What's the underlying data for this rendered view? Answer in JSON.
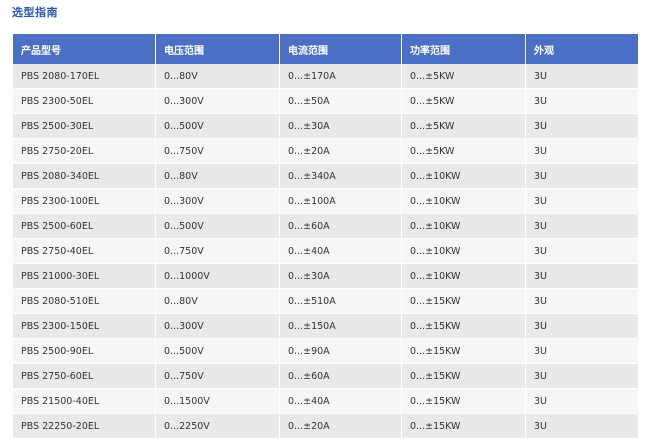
{
  "title": "选型指南",
  "table": {
    "headers": [
      "产品型号",
      "电压范围",
      "电流范围",
      "功率范围",
      "外观"
    ],
    "rows": [
      [
        "PBS 2080-170EL",
        "0...80V",
        "0...±170A",
        "0...±5KW",
        "3U"
      ],
      [
        "PBS 2300-50EL",
        "0...300V",
        "0...±50A",
        "0...±5KW",
        "3U"
      ],
      [
        "PBS 2500-30EL",
        "0...500V",
        "0...±30A",
        "0...±5KW",
        "3U"
      ],
      [
        "PBS 2750-20EL",
        "0...750V",
        "0...±20A",
        "0...±5KW",
        "3U"
      ],
      [
        "PBS 2080-340EL",
        "0...80V",
        "0...±340A",
        "0...±10KW",
        "3U"
      ],
      [
        "PBS 2300-100EL",
        "0...300V",
        "0...±100A",
        "0...±10KW",
        "3U"
      ],
      [
        "PBS 2500-60EL",
        "0...500V",
        "0...±60A",
        "0...±10KW",
        "3U"
      ],
      [
        "PBS 2750-40EL",
        "0...750V",
        "0...±40A",
        "0...±10KW",
        "3U"
      ],
      [
        "PBS 21000-30EL",
        "0...1000V",
        "0...±30A",
        "0...±10KW",
        "3U"
      ],
      [
        "PBS 2080-510EL",
        "0...80V",
        "0...±510A",
        "0...±15KW",
        "3U"
      ],
      [
        "PBS 2300-150EL",
        "0...300V",
        "0...±150A",
        "0...±15KW",
        "3U"
      ],
      [
        "PBS 2500-90EL",
        "0...500V",
        "0...±90A",
        "0...±15KW",
        "3U"
      ],
      [
        "PBS 2750-60EL",
        "0...750V",
        "0...±60A",
        "0...±15KW",
        "3U"
      ],
      [
        "PBS 21500-40EL",
        "0...1500V",
        "0...±40A",
        "0...±15KW",
        "3U"
      ],
      [
        "PBS 22250-20EL",
        "0...2250V",
        "0...±20A",
        "0...±15KW",
        "3U"
      ]
    ]
  },
  "colors": {
    "title": "#2f58b4",
    "header_bg": "#4a6fc4",
    "row_odd": "#e9e9e9",
    "row_even": "#f6f6f6"
  }
}
